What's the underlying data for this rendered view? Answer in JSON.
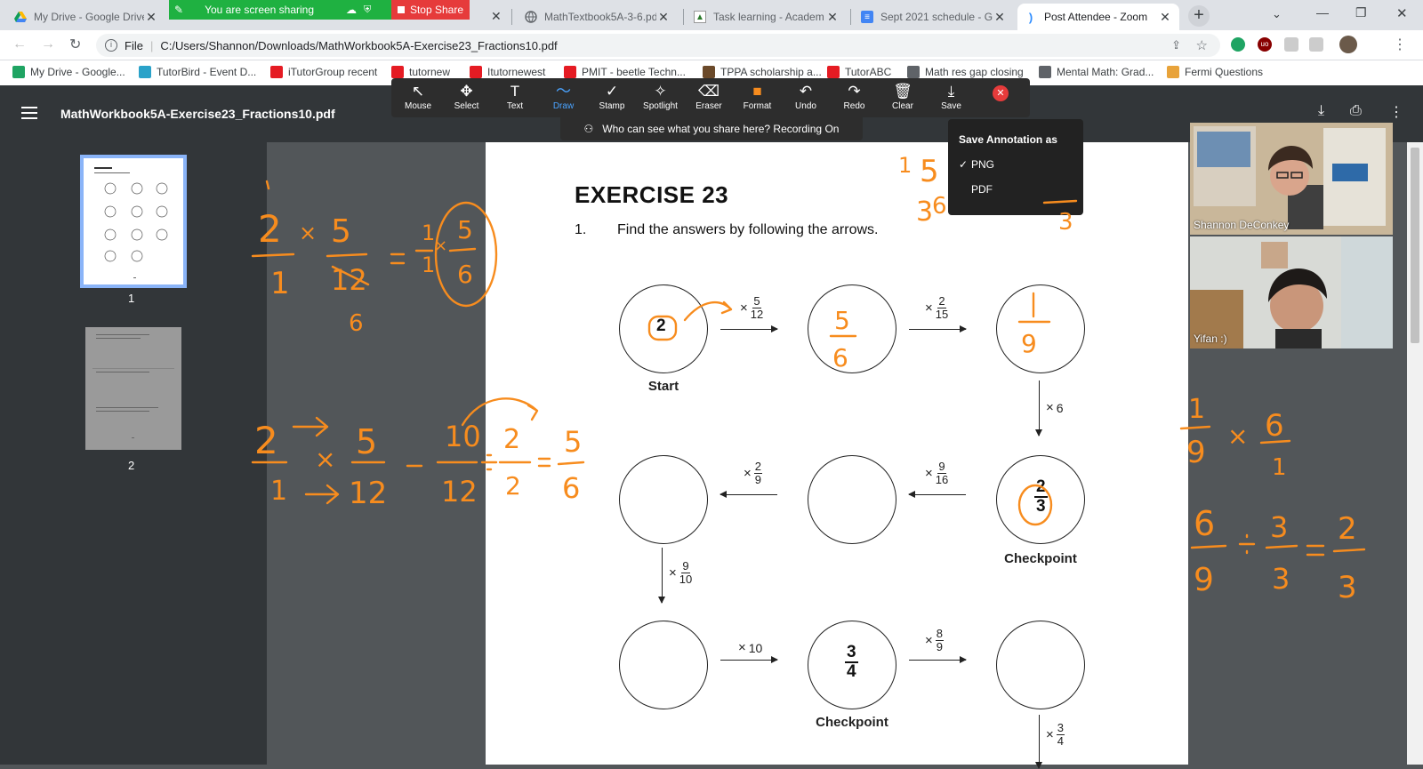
{
  "browser": {
    "tabs": [
      {
        "title": "My Drive - Google Drive",
        "icon": "google-drive-icon",
        "active": false
      },
      {
        "title": "MathTextbook5A-3-6.pdf",
        "icon": "globe-icon",
        "active": false
      },
      {
        "title": "Task learning - Academ",
        "icon": "document-icon",
        "active": false
      },
      {
        "title": "Sept 2021 schedule - G",
        "icon": "google-docs-icon",
        "active": false
      },
      {
        "title": "Post Attendee - Zoom",
        "icon": "zoom-icon",
        "active": true
      }
    ],
    "new_tab": "+",
    "address": {
      "scheme": "File",
      "url": "C:/Users/Shannon/Downloads/MathWorkbook5A-Exercise23_Fractions10.pdf"
    },
    "bookmarks": [
      {
        "label": "My Drive - Google...",
        "color": "#1fa463"
      },
      {
        "label": "TutorBird - Event D...",
        "color": "#2aa2c9"
      },
      {
        "label": "iTutorGroup recent",
        "color": "#e51b23"
      },
      {
        "label": "tutornew",
        "color": "#e51b23"
      },
      {
        "label": "Itutornewest",
        "color": "#e51b23"
      },
      {
        "label": "PMIT - beetle Techn...",
        "color": "#e51b23"
      },
      {
        "label": "TPPA scholarship a...",
        "color": "#6b4a2a"
      },
      {
        "label": "TutorABC",
        "color": "#e51b23"
      },
      {
        "label": "Math res gap closing",
        "color": "#5f6368"
      },
      {
        "label": "Mental Math: Grad...",
        "color": "#5f6368"
      },
      {
        "label": "Fermi Questions",
        "color": "#e8a33a"
      }
    ]
  },
  "zoom": {
    "sharing_banner": "You are screen sharing",
    "stop_share": "Stop Share",
    "annotation_tools": [
      "Mouse",
      "Select",
      "Text",
      "Draw",
      "Stamp",
      "Spotlight",
      "Eraser",
      "Format",
      "Undo",
      "Redo",
      "Clear",
      "Save"
    ],
    "active_tool": "Draw",
    "visibility_notice": "Who can see what you share here? Recording On",
    "save_popup": {
      "title": "Save Annotation as",
      "options": [
        "PNG",
        "PDF"
      ],
      "selected": "PNG"
    },
    "participants": [
      {
        "name": "Shannon DeConkey"
      },
      {
        "name": "Yifan :)"
      }
    ]
  },
  "pdf": {
    "file_name": "MathWorkbook5A-Exercise23_Fractions10.pdf",
    "thumbnails": [
      {
        "label": "1"
      },
      {
        "label": "2"
      }
    ],
    "exercise_title": "EXERCISE 23",
    "question_number": "1.",
    "question_text": "Find the answers by following the arrows.",
    "diagram": {
      "start_value": "2",
      "start_label": "Start",
      "checkpoint_label": "Checkpoint",
      "checkpoint1": {
        "num": "2",
        "den": "3"
      },
      "checkpoint2": {
        "num": "3",
        "den": "4"
      },
      "ops": {
        "op1": {
          "sign": "×",
          "num": "5",
          "den": "12"
        },
        "op2": {
          "sign": "×",
          "num": "2",
          "den": "15"
        },
        "op3": {
          "sign": "×",
          "whole": "6"
        },
        "op4": {
          "sign": "×",
          "num": "9",
          "den": "16"
        },
        "op5": {
          "sign": "×",
          "num": "2",
          "den": "9"
        },
        "op6": {
          "sign": "×",
          "num": "9",
          "den": "10"
        },
        "op7": {
          "sign": "×",
          "whole": "10"
        },
        "op8": {
          "sign": "×",
          "num": "8",
          "den": "9"
        },
        "op9": {
          "sign": "×",
          "num": "3",
          "den": "4"
        }
      }
    }
  },
  "colors": {
    "annotation_ink": "#f78c1e",
    "stop_share": "#e63b3b",
    "sharing_banner": "#1fb141"
  }
}
